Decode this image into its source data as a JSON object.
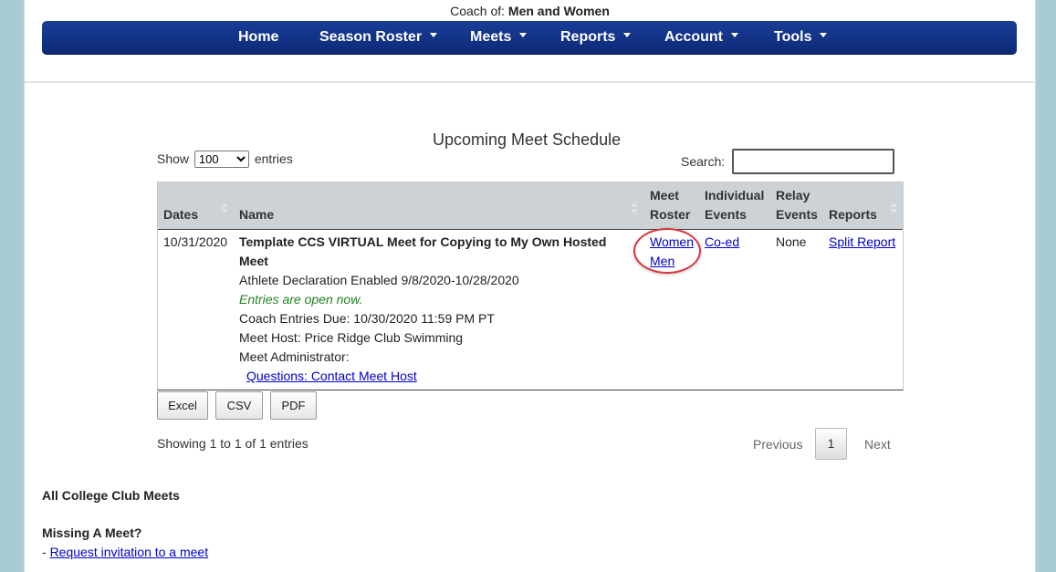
{
  "header": {
    "coach_prefix": "Coach of:",
    "coach_value": "Men and Women"
  },
  "nav": {
    "home": "Home",
    "season_roster": "Season Roster",
    "meets": "Meets",
    "reports": "Reports",
    "account": "Account",
    "tools": "Tools"
  },
  "table_title": "Upcoming Meet Schedule",
  "length": {
    "show": "Show",
    "value": "100",
    "entries": "entries"
  },
  "search": {
    "label": "Search:",
    "value": ""
  },
  "columns": {
    "dates": "Dates",
    "name": "Name",
    "meet_roster": [
      "Meet",
      "Roster"
    ],
    "individual_events": [
      "Individual",
      "Events"
    ],
    "relay_events": [
      "Relay",
      "Events"
    ],
    "reports": "Reports"
  },
  "row": {
    "date": "10/31/2020",
    "name_line1": "Template CCS VIRTUAL Meet for Copying to My Own Hosted",
    "name_line2": "Meet",
    "declaration": "Athlete Declaration Enabled 9/8/2020-10/28/2020",
    "entries_status": "Entries are open now.",
    "entries_due": "Coach Entries Due: 10/30/2020 11:59 PM PT",
    "host": "Meet Host: Price Ridge Club Swimming",
    "administrator": "Meet Administrator:",
    "contact_link": "Questions: Contact Meet Host",
    "roster_women": "Women",
    "roster_men": "Men",
    "individual": "Co-ed",
    "relay": "None",
    "report": "Split Report"
  },
  "buttons": {
    "excel": "Excel",
    "csv": "CSV",
    "pdf": "PDF"
  },
  "info": "Showing 1 to 1 of 1 entries",
  "pagination": {
    "previous": "Previous",
    "page": "1",
    "next": "Next"
  },
  "footer": {
    "all_meets": "All College Club Meets",
    "missing": "Missing A Meet?",
    "dash": "-",
    "request_link": "Request invitation to a meet"
  },
  "colors": {
    "nav_blue": "#1a3d96",
    "link": "#0000cc",
    "status_green": "#208020",
    "highlight_circle": "#d9363e"
  }
}
